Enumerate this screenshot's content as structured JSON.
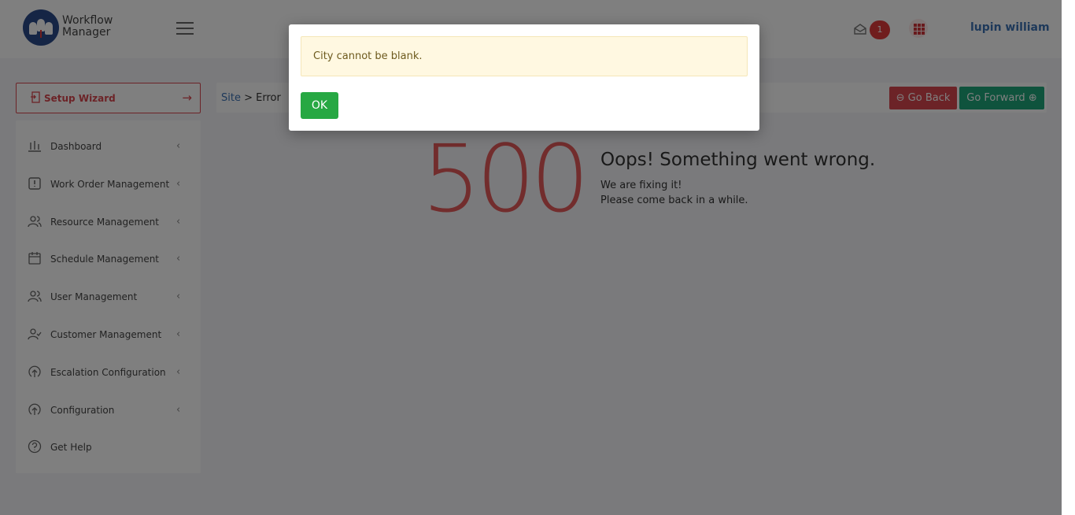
{
  "app": {
    "brand_line1": "Workflow",
    "brand_line2": "Manager"
  },
  "header": {
    "notification_count": "1",
    "user_name": "lupin william"
  },
  "sidebar": {
    "wizard_label": "Setup Wizard",
    "items": [
      {
        "label": "Dashboard",
        "icon": "chart-icon"
      },
      {
        "label": "Work Order Management",
        "icon": "work-order-icon"
      },
      {
        "label": "Resource Management",
        "icon": "users-icon"
      },
      {
        "label": "Schedule Management",
        "icon": "calendar-icon"
      },
      {
        "label": "User Management",
        "icon": "users-icon"
      },
      {
        "label": "Customer Management",
        "icon": "user-check-icon"
      },
      {
        "label": "Escalation Configuration",
        "icon": "upload-icon"
      },
      {
        "label": "Configuration",
        "icon": "upload-icon"
      },
      {
        "label": "Get Help",
        "icon": "help-icon"
      }
    ]
  },
  "breadcrumb": {
    "link": "Site",
    "separator": ">",
    "current": "Error"
  },
  "actions": {
    "back_label": "Go Back",
    "forward_label": "Go Forward"
  },
  "error": {
    "code": "500",
    "title": "Oops! Something went wrong.",
    "line1": "We are fixing it!",
    "line2": "Please come back in a while."
  },
  "modal": {
    "message": "City cannot be blank.",
    "ok_label": "OK"
  },
  "colors": {
    "accent_red": "#d9464e",
    "accent_green": "#1fa67a",
    "ok_green": "#27a843",
    "link_blue": "#3d72b4"
  }
}
